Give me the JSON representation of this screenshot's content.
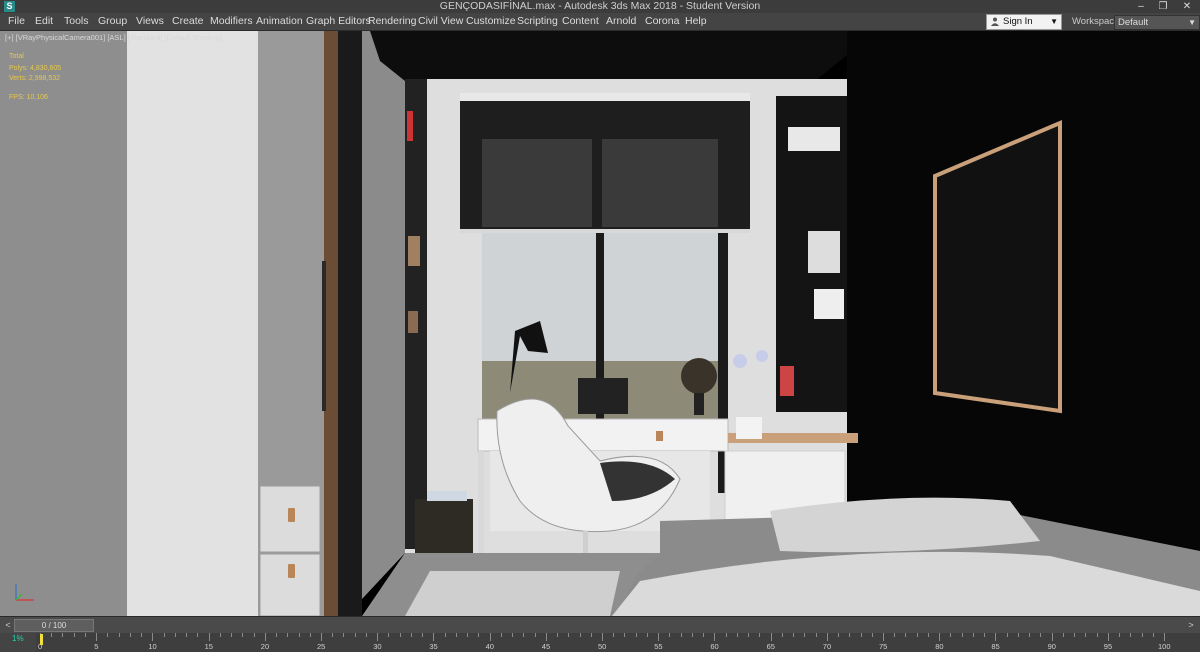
{
  "window": {
    "title": "GENÇODASIFİNAL.max - Autodesk 3ds Max 2018 - Student Version",
    "app_icon_letter": "S",
    "minimize_glyph": "–",
    "restore_glyph": "❐",
    "close_glyph": "✕"
  },
  "menu": [
    "File",
    "Edit",
    "Tools",
    "Group",
    "Views",
    "Create",
    "Modifiers",
    "Animation",
    "Graph Editors",
    "Rendering",
    "Civil View",
    "Customize",
    "Scripting",
    "Content",
    "Arnold",
    "Corona",
    "Help"
  ],
  "account": {
    "sign_in": "Sign In",
    "dropdown_glyph": "▼"
  },
  "workspace": {
    "label": "Workspaces:",
    "value": "Default",
    "dropdown_glyph": "▼"
  },
  "viewport": {
    "label": "[+] [VRayPhysicalCamera001] [ASL] [Standard] [Default Shading]",
    "stats": [
      {
        "label": "Total",
        "value": ""
      },
      {
        "label": "Polys:",
        "value": "4,830,605"
      },
      {
        "label": "Verts:",
        "value": "2,998,532"
      },
      {
        "label": "FPS:",
        "value": "10,106"
      }
    ]
  },
  "time_slider": {
    "value": "0 / 100",
    "prev_glyph": "<",
    "next_glyph": ">"
  },
  "track_bar": {
    "corner_icon": "1%",
    "ticks": [
      "0",
      "5",
      "10",
      "15",
      "20",
      "25",
      "30",
      "35",
      "40",
      "45",
      "50",
      "55",
      "60",
      "65",
      "70",
      "75",
      "80",
      "85",
      "90",
      "95",
      "100"
    ]
  },
  "colors": {
    "chrome": "#444444",
    "viewport_bg": "#000000",
    "stats_text": "#e6c84a",
    "playhead": "#f1e03a",
    "wood_accent": "#c9a07a"
  }
}
